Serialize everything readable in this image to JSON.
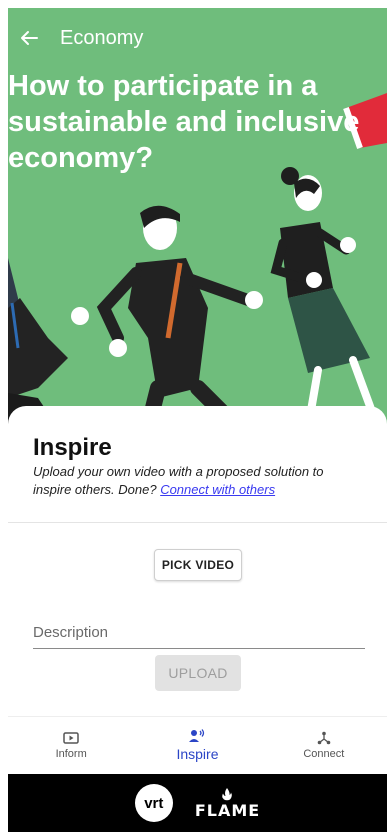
{
  "app_bar": {
    "title": "Economy",
    "back_icon": "arrow-left-icon"
  },
  "hero": {
    "headline": "How to participate in a sustainable and inclusive economy?",
    "bg_color": "#6fbd7c"
  },
  "inspire": {
    "title": "Inspire",
    "description": "Upload your own video with a proposed solution to inspire others. Done? ",
    "link_text": "Connect with others",
    "pick_video_label": "PICK VIDEO",
    "description_placeholder": "Description",
    "upload_label": "UPLOAD"
  },
  "bottom_nav": {
    "items": [
      {
        "label": "Inform",
        "icon": "video-play-icon",
        "active": false
      },
      {
        "label": "Inspire",
        "icon": "speaker-person-icon",
        "active": true
      },
      {
        "label": "Connect",
        "icon": "network-icon",
        "active": false
      }
    ],
    "accent": "#2b45c6"
  },
  "footer": {
    "vrt_logo": "vrt",
    "flame_logo": "FLAME"
  }
}
